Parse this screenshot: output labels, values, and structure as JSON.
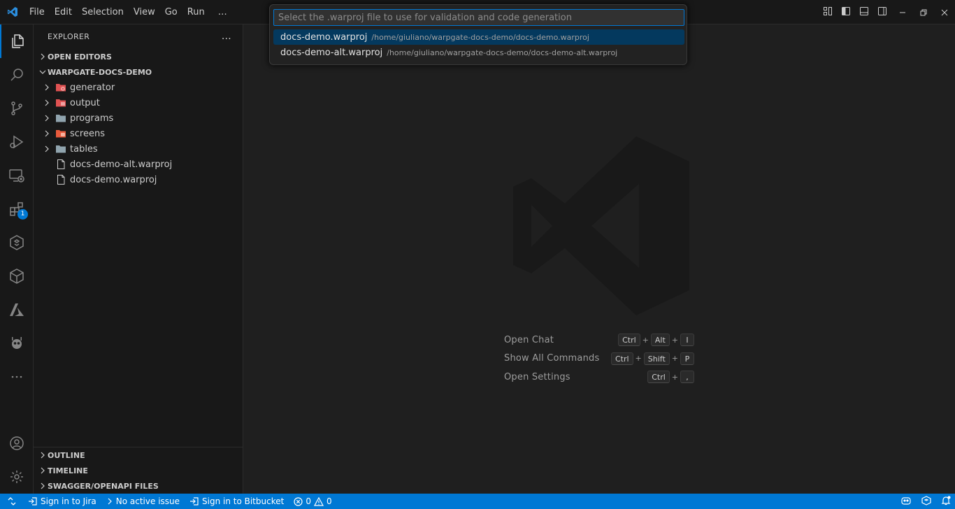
{
  "menu": [
    "File",
    "Edit",
    "Selection",
    "View",
    "Go",
    "Run",
    "…"
  ],
  "sidebar": {
    "title": "EXPLORER",
    "more": "…",
    "open_editors": "OPEN EDITORS",
    "workspace": "WARPGATE-DOCS-DEMO",
    "folders": [
      {
        "label": "generator",
        "icon": "generator-folder-icon",
        "color": "#e05252"
      },
      {
        "label": "output",
        "icon": "output-folder-icon",
        "color": "#e05252"
      },
      {
        "label": "programs",
        "icon": "folder-icon",
        "color": "#90a4ae"
      },
      {
        "label": "screens",
        "icon": "screens-folder-icon",
        "color": "#e85a3c"
      },
      {
        "label": "tables",
        "icon": "folder-icon",
        "color": "#90a4ae"
      }
    ],
    "files": [
      "docs-demo-alt.warproj",
      "docs-demo.warproj"
    ],
    "outline": "OUTLINE",
    "timeline": "TIMELINE",
    "swagger": "SWAGGER/OPENAPI FILES"
  },
  "activity_badge": "1",
  "quickpick": {
    "placeholder": "Select the .warproj file to use for validation and code generation",
    "items": [
      {
        "name": "docs-demo.warproj",
        "path": "/home/giuliano/warpgate-docs-demo/docs-demo.warproj"
      },
      {
        "name": "docs-demo-alt.warproj",
        "path": "/home/giuliano/warpgate-docs-demo/docs-demo-alt.warproj"
      }
    ]
  },
  "shortcuts": [
    {
      "label": "Open Chat",
      "keys": [
        "Ctrl",
        "Alt",
        "I"
      ]
    },
    {
      "label": "Show All Commands",
      "keys": [
        "Ctrl",
        "Shift",
        "P"
      ]
    },
    {
      "label": "Open Settings",
      "keys": [
        "Ctrl",
        ","
      ]
    }
  ],
  "status": {
    "jira": "Sign in to Jira",
    "issue": "No active issue",
    "bitbucket": "Sign in to Bitbucket",
    "errors": "0",
    "warnings": "0"
  },
  "colors": {
    "accent": "#0078d4",
    "selection": "#04395e"
  }
}
